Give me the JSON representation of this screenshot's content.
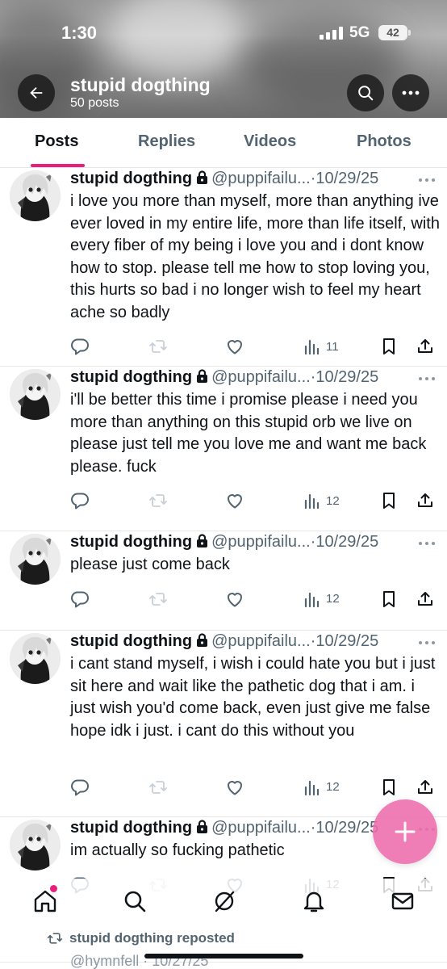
{
  "status_bar": {
    "time": "1:30",
    "network": "5G",
    "battery": "42"
  },
  "profile": {
    "name": "stupid dogthing",
    "post_count": "50 posts"
  },
  "tabs": [
    {
      "label": "Posts",
      "active": true
    },
    {
      "label": "Replies",
      "active": false
    },
    {
      "label": "Videos",
      "active": false
    },
    {
      "label": "Photos",
      "active": false
    }
  ],
  "posts": [
    {
      "name": "stupid dogthing",
      "handle": "@puppifailu...",
      "separator": "·",
      "date": "10/29/25",
      "text": "i love you more than myself, more than anything ive ever loved in my entire life, more than life itself, with every fiber of my being i love you and i dont know how to stop. please tell me how to stop loving you, this hurts so bad i no longer wish to feel my heart ache so badly",
      "views": "11"
    },
    {
      "name": "stupid dogthing",
      "handle": "@puppifailu...",
      "separator": "·",
      "date": "10/29/25",
      "text": "i'll be better this time i promise please i need you more than anything on this stupid orb we live on please just tell me you love me and want me back please. fuck",
      "views": "12"
    },
    {
      "name": "stupid dogthing",
      "handle": "@puppifailu...",
      "separator": "·",
      "date": "10/29/25",
      "text": "please just come back",
      "views": "12"
    },
    {
      "name": "stupid dogthing",
      "handle": "@puppifailu...",
      "separator": "·",
      "date": "10/29/25",
      "text": "i cant stand myself, i wish i could hate you but i just sit here and wait like the pathetic dog that i am. i just wish you'd come back, even just give me false hope idk i just. i cant do this without you",
      "views": "12"
    },
    {
      "name": "stupid dogthing",
      "handle": "@puppifailu...",
      "separator": "·",
      "date": "10/29/25",
      "text": "im actually so fucking pathetic",
      "views": "12"
    }
  ],
  "repost_hint": {
    "label": "stupid dogthing reposted",
    "next_handle": "@hymnfell · 10/27/25"
  },
  "icons": {
    "back": "arrow-left-icon",
    "search": "search-icon",
    "more": "more-icon",
    "reply": "reply-icon",
    "repost": "repost-icon",
    "like": "heart-icon",
    "views": "views-icon",
    "bookmark": "bookmark-icon",
    "share": "share-icon",
    "lock": "lock-icon",
    "compose": "plus-icon",
    "nav": [
      "home-icon",
      "explore-icon",
      "grok-icon",
      "notifications-icon",
      "messages-icon"
    ]
  },
  "colors": {
    "accent": "#e91e7a",
    "fab": "#ed6cac",
    "text": "#0f1419",
    "muted": "#536471"
  }
}
